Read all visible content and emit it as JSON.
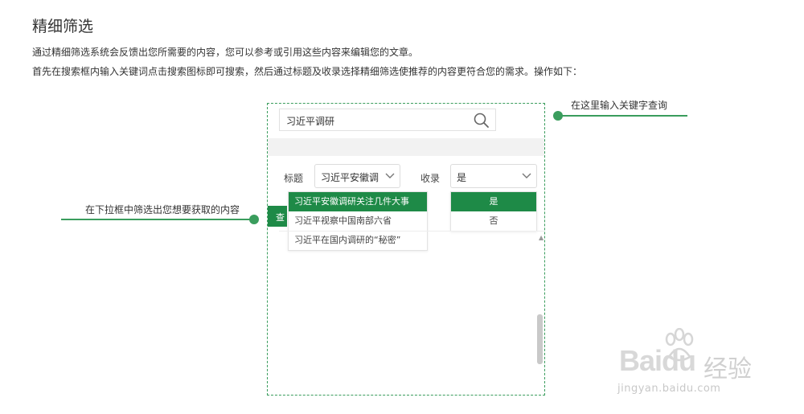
{
  "header": {
    "title": "精细筛选",
    "desc1": "通过精细筛选系统会反馈出您所需要的内容，您可以参考或引用这些内容来编辑您的文章。",
    "desc2": "首先在搜索框内输入关键词点击搜索图标即可搜索，然后通过标题及收录选择精细筛选使推荐的内容更符合您的需求。操作如下："
  },
  "callouts": {
    "right": "在这里输入关键字查询",
    "left": "在下拉框中筛选出您想要获取的内容"
  },
  "search": {
    "value": "习近平调研",
    "icon": "search-icon"
  },
  "filters": {
    "title_label": "标题",
    "title_value": "习近平安徽调",
    "index_label": "收录",
    "index_value": "是"
  },
  "title_dropdown": {
    "items": [
      "习近平安徽调研关注几件大事",
      "习近平视察中国南部六省",
      "习近平在国内调研的“秘密”"
    ],
    "selected_index": 0
  },
  "index_dropdown": {
    "items": [
      "是",
      "否"
    ],
    "selected_index": 0
  },
  "edge_button": {
    "label": "查"
  },
  "watermark": {
    "brand": "Bai",
    "brand2": "du",
    "product": "经验",
    "url": "jingyan.baidu.com"
  },
  "colors": {
    "accent": "#1e8a47",
    "callout": "#3a9d5d"
  }
}
